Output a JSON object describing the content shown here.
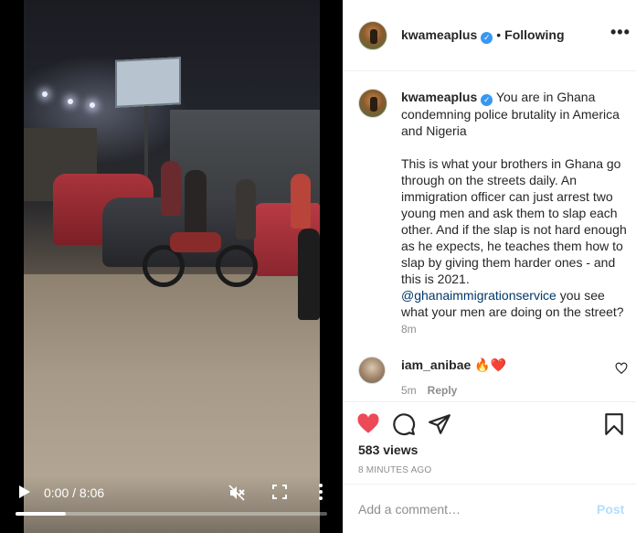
{
  "video": {
    "current_time": "0:00",
    "duration": "8:06",
    "time_label": "0:00 / 8:06",
    "progress_fraction": 0.16
  },
  "header": {
    "username": "kwameaplus",
    "separator": "•",
    "follow_status": "Following",
    "more_label": "•••"
  },
  "caption": {
    "username": "kwameaplus",
    "paragraph1": "You are in Ghana condemning police brutality in America and Nigeria",
    "paragraph2_text": "This is what your brothers in Ghana go through on the streets daily. An immigration officer can just arrest two young men and ask them to slap each other. And if the slap is not hard enough as he expects, he teaches them how to slap by giving them harder ones - and this is 2021.",
    "mention": "@ghanaimmigrationservice",
    "paragraph2_tail": "you see what your men are doing on the street?",
    "time": "8m"
  },
  "comment": {
    "username": "iam_anibae",
    "text": "🔥❤️",
    "time": "5m",
    "reply_label": "Reply"
  },
  "actions": {
    "views": "583 views",
    "age": "8 MINUTES AGO"
  },
  "add_comment": {
    "placeholder": "Add a comment…",
    "post_label": "Post"
  },
  "colors": {
    "like_red": "#ed4956",
    "verified_blue": "#3897f0",
    "post_disabled": "#b2dffc",
    "mention": "#00376b"
  },
  "icons": [
    "play-icon",
    "mute-icon",
    "fullscreen-icon",
    "more-vertical-icon",
    "verified-icon",
    "more-horizontal-icon",
    "heart-filled-icon",
    "comment-icon",
    "share-icon",
    "bookmark-icon",
    "heart-outline-icon"
  ]
}
